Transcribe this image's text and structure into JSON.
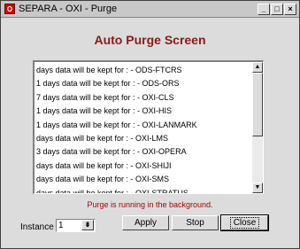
{
  "window": {
    "title": "SEPARA - OXI - Purge",
    "app_icon": "O",
    "minimize_symbol": "_",
    "maximize_symbol": "□",
    "close_symbol": "×"
  },
  "heading": "Auto Purge Screen",
  "list": {
    "items": [
      "days data will be kept for : - ODS-FTCRS",
      "1 days data will be kept for : - ODS-ORS",
      "7 days data will be kept for : - OXI-CLS",
      "1 days data will be kept for : - OXI-HIS",
      "1 days data will be kept for : - OXI-LANMARK",
      "days data will be kept for : - OXI-LMS",
      "3 days data will be kept for : - OXI-OPERA",
      "days data will be kept for : - OXI-SHIJI",
      "days data will be kept for : - OXI-SMS",
      "days data will be kept for : - OXI-STRATUS"
    ],
    "scroll_up_symbol": "▲",
    "scroll_down_symbol": "▼"
  },
  "status_text": "Purge is running in the background.",
  "instance": {
    "label": "Instance",
    "value": "1",
    "button_symbol": "⇟"
  },
  "buttons": {
    "apply": "Apply",
    "stop": "Stop",
    "close": "Close"
  },
  "colors": {
    "heading": "#8b1a1a",
    "status": "#b00000",
    "window_bg": "#dcdcdc"
  }
}
